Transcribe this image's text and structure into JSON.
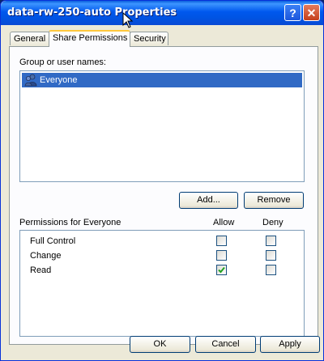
{
  "window": {
    "title": "data-rw-250-auto Properties",
    "help_glyph": "?",
    "close_glyph": "✕"
  },
  "tabs": [
    {
      "label": "General",
      "active": false
    },
    {
      "label": "Share Permissions",
      "active": true
    },
    {
      "label": "Security",
      "active": false
    }
  ],
  "group_section": {
    "label": "Group or user names:",
    "items": [
      {
        "name": "Everyone",
        "icon": "users-group-icon",
        "selected": true
      }
    ]
  },
  "group_buttons": {
    "add_label": "Add...",
    "remove_label": "Remove"
  },
  "permissions": {
    "header": "Permissions for Everyone",
    "allow_label": "Allow",
    "deny_label": "Deny",
    "rows": [
      {
        "name": "Full Control",
        "allow": false,
        "deny": false
      },
      {
        "name": "Change",
        "allow": false,
        "deny": false
      },
      {
        "name": "Read",
        "allow": true,
        "deny": false
      }
    ]
  },
  "dialog_buttons": {
    "ok_label": "OK",
    "cancel_label": "Cancel",
    "apply_label": "Apply"
  },
  "colors": {
    "titlebar": "#0054e3",
    "selection": "#316ac5",
    "checkmark": "#21a121",
    "tab_highlight": "#ffc83c"
  }
}
